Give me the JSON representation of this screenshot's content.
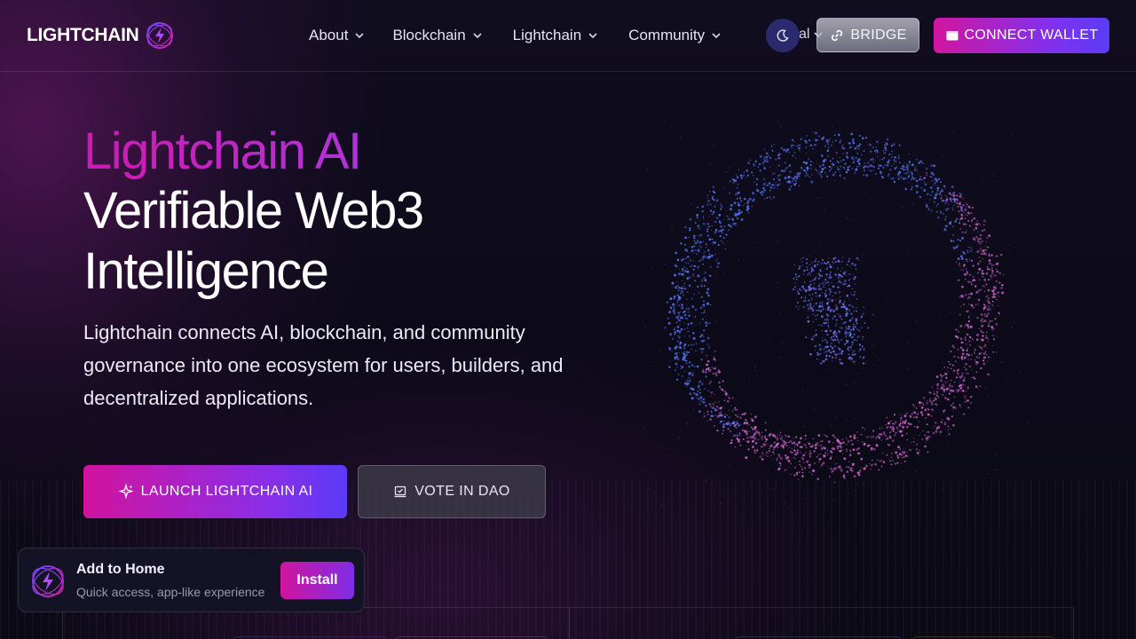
{
  "header": {
    "logo_text": "LIGHTCHAIN",
    "nav": [
      {
        "label": "About"
      },
      {
        "label": "Blockchain"
      },
      {
        "label": "Lightchain"
      },
      {
        "label": "Community"
      }
    ],
    "language_fragment": "al",
    "bridge_label": "BRIDGE",
    "wallet_label": "CONNECT WALLET"
  },
  "hero": {
    "title_line1": "Lightchain AI",
    "title_line2": "Verifiable Web3",
    "title_line3": "Intelligence",
    "description": "Lightchain connects AI, blockchain, and community governance into one ecosystem for users, builders, and decentralized applications.",
    "primary_cta": "LAUNCH LIGHTCHAIN AI",
    "secondary_cta": "VOTE IN DAO"
  },
  "install_prompt": {
    "title": "Add to Home",
    "subtitle": "Quick access, app-like experience",
    "button": "Install"
  },
  "colors": {
    "accent_pink": "#d2139e",
    "accent_violet": "#5a3bf6",
    "background": "#0b0a17"
  }
}
